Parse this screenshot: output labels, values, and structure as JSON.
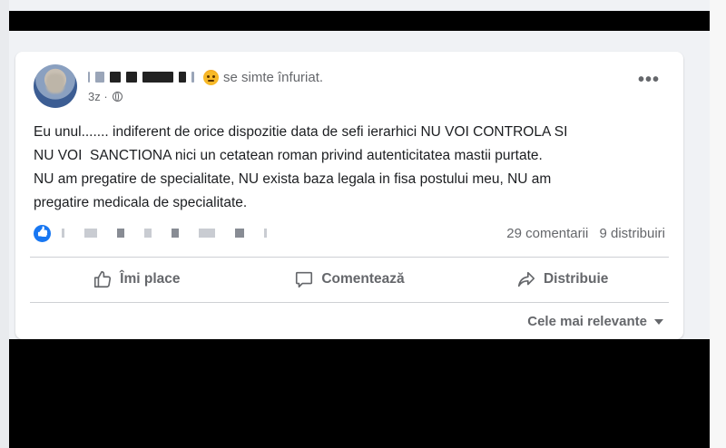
{
  "post": {
    "feeling": "se simte înfuriat.",
    "time": "3z ·",
    "more": "•••",
    "lines": [
      "Eu unul....... indiferent de orice dispozitie data de sefi ierarhici NU VOI CONTROLA SI",
      "NU VOI  SANCTIONA nici un cetatean roman privind autenticitatea mastii purtate.",
      "NU am pregatire de specialitate, NU exista baza legala in fisa postului meu, NU am",
      "pregatire medicala de specialitate."
    ],
    "comments": "29 comentarii",
    "shares": "9 distribuiri"
  },
  "actions": {
    "like": "Îmi place",
    "comment": "Comentează",
    "share": "Distribuie"
  },
  "sort": {
    "label": "Cele mai relevante"
  },
  "icons": {
    "feeling": "angry-emoji-icon",
    "privacy": "globe-icon",
    "reaction": "like-reaction-icon",
    "like": "thumbs-up-icon",
    "comment": "comment-bubble-icon",
    "share": "share-arrow-icon",
    "sort": "caret-down-icon"
  },
  "colors": {
    "brand": "#1877f2",
    "muted_text": "#65676b",
    "background": "#f0f2f5"
  }
}
